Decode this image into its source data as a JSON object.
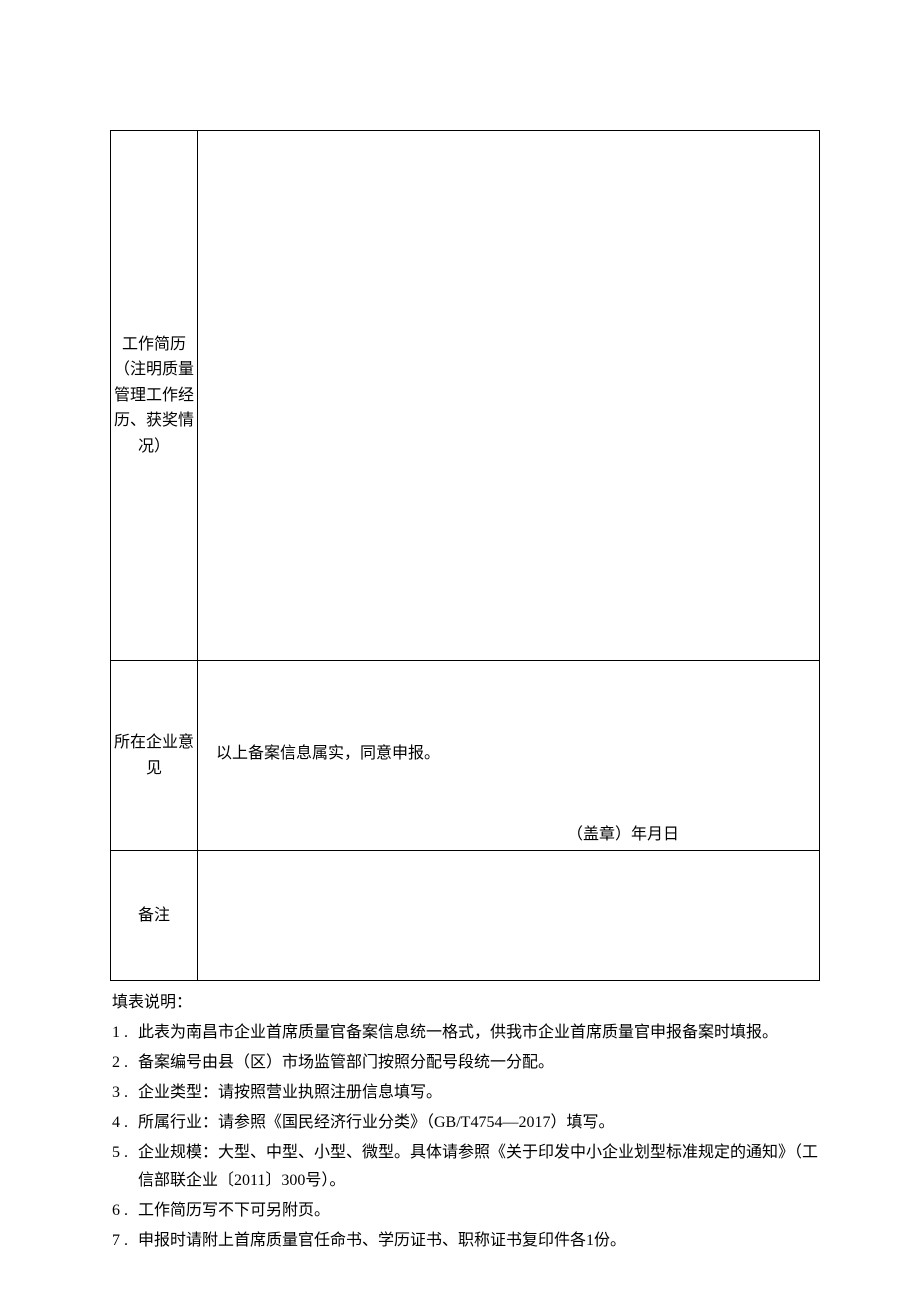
{
  "table": {
    "rows": {
      "work_history_label": "工作简历（注明质量管理工作经历、获奖情况）",
      "opinion_label": "所在企业意见",
      "opinion_text": "以上备案信息属实，同意申报。",
      "stamp_line": "（盖章）年月日",
      "remark_label": "备注"
    }
  },
  "notes": {
    "title": "填表说明：",
    "items": [
      {
        "n": "1 .",
        "text": "此表为南昌市企业首席质量官备案信息统一格式，供我市企业首席质量官申报备案时填报。"
      },
      {
        "n": "2 .",
        "text": "备案编号由县（区）市场监管部门按照分配号段统一分配。"
      },
      {
        "n": "3 .",
        "text": "企业类型：请按照营业执照注册信息填写。"
      },
      {
        "n": "4 .",
        "text": "所属行业：请参照《国民经济行业分类》（GB/T4754—2017）填写。"
      },
      {
        "n": "5 .",
        "text": "企业规模：大型、中型、小型、微型。具体请参照《关于印发中小企业划型标准规定的通知》（工信部联企业〔2011〕300号）。"
      },
      {
        "n": "6 .",
        "text": "工作简历写不下可另附页。"
      },
      {
        "n": "7 .",
        "text": "申报时请附上首席质量官任命书、学历证书、职称证书复印件各1份。"
      }
    ]
  }
}
